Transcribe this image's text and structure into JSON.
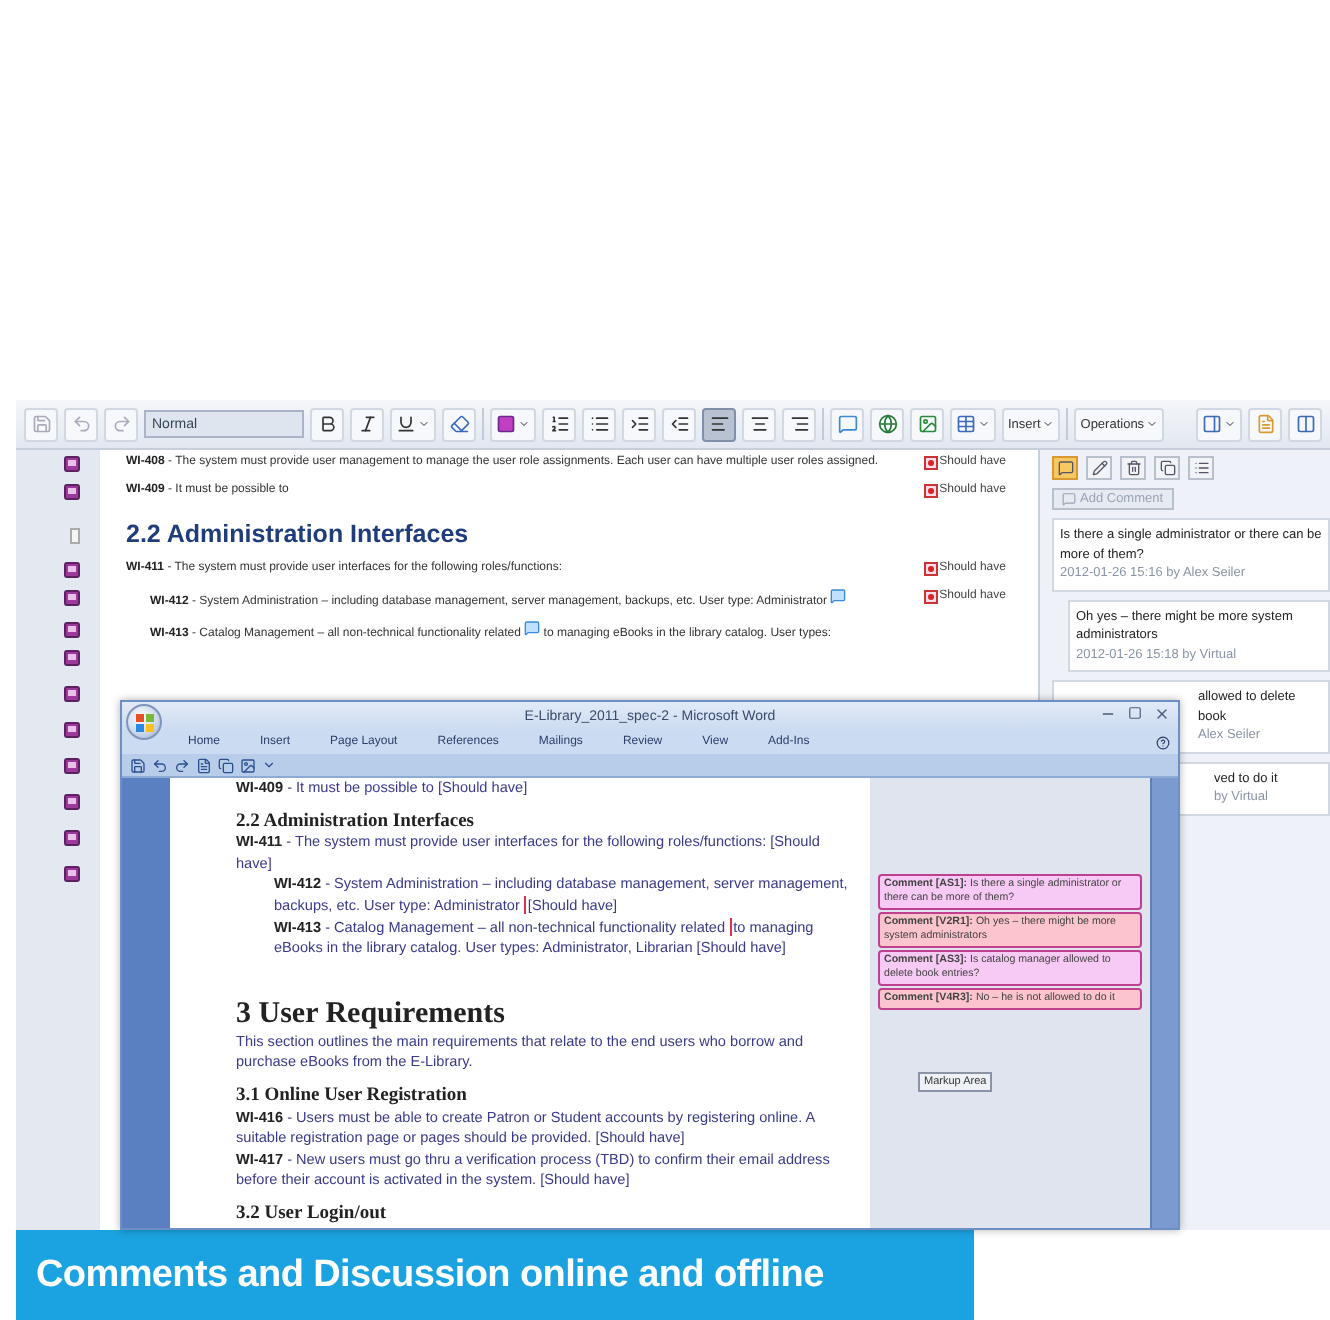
{
  "toolbar": {
    "style": "Normal",
    "insert": "Insert",
    "operations": "Operations",
    "align_buttons": [
      {
        "kind": "left",
        "selected": true
      },
      {
        "kind": "center",
        "selected": false
      },
      {
        "kind": "right",
        "selected": false
      }
    ]
  },
  "document": {
    "rows": [
      {
        "kind": "requirement",
        "id": "WI-408",
        "text": "- The system must provide user management to manage the user role assignments. Each user can have multiple user roles assigned.",
        "priority": "Should have"
      },
      {
        "kind": "requirement",
        "id": "WI-409",
        "text": "- It must be possible to",
        "priority": "Should have"
      },
      {
        "kind": "heading",
        "text": "2.2 Administration Interfaces"
      },
      {
        "kind": "requirement",
        "id": "WI-411",
        "text": "- The system must provide user interfaces for the following roles/functions:",
        "priority": "Should have",
        "children": [
          {
            "kind": "requirement",
            "id": "WI-412",
            "text": "- System Administration – including database management, server management, backups, etc. User type: Administrator",
            "has_comment": true,
            "priority": "Should have"
          },
          {
            "kind": "requirement",
            "id": "WI-413",
            "text": "- Catalog Management – all non-technical functionality related",
            "has_comment": true,
            "text_after": "to managing eBooks in the library catalog. User types:"
          }
        ]
      }
    ]
  },
  "side_panel": {
    "tools": [
      {
        "kind": "comment",
        "selected": true
      },
      {
        "kind": "edit",
        "selected": false
      },
      {
        "kind": "delete",
        "selected": false
      },
      {
        "kind": "copy",
        "selected": false
      },
      {
        "kind": "list",
        "selected": false
      }
    ],
    "add_comment": {
      "label": "Add Comment",
      "disabled": true
    },
    "comments": [
      {
        "kind": "full",
        "reply": false,
        "text": "Is there a single administrator or there can be more of them?",
        "meta": "2012-01-26 15:16 by Alex Seiler"
      },
      {
        "kind": "full",
        "reply": true,
        "text": "Oh yes – there might be more system administrators",
        "meta": "2012-01-26 15:18 by Virtual"
      },
      {
        "kind": "partial",
        "reply": false,
        "text": "allowed to delete book",
        "meta": "Alex Seiler"
      },
      {
        "kind": "partial",
        "reply": true,
        "text": "ved to do it",
        "meta": "by Virtual"
      }
    ]
  },
  "word": {
    "title": "E-Library_2011_spec-2 - Microsoft Word",
    "tabs": [
      "Home",
      "Insert",
      "Page Layout",
      "References",
      "Mailings",
      "Review",
      "View",
      "Add-Ins"
    ],
    "content": [
      {
        "kind": "req",
        "id": "WI-409",
        "text": "- It must be possible to [Should have]"
      },
      {
        "kind": "h2",
        "text": "2.2 Administration Interfaces"
      },
      {
        "kind": "req",
        "id": "WI-411",
        "text": "- The system must provide user interfaces for the following roles/functions: [Should have]",
        "children": [
          {
            "kind": "req",
            "id": "WI-412",
            "text": "- System Administration – including database management, server management, backups, etc. User type: Administrator",
            "marked": "[Should have]"
          },
          {
            "kind": "req",
            "id": "WI-413",
            "text": "- Catalog Management – all non-technical functionality related",
            "marked": "to managing eBooks",
            "text_after": "in the library catalog. User types: Administrator, Librarian [Should have]"
          }
        ]
      },
      {
        "kind": "h1",
        "text": "3 User Requirements"
      },
      {
        "kind": "p",
        "text": "This section outlines the main requirements that relate to the end users who borrow and purchase eBooks from the E-Library."
      },
      {
        "kind": "h2",
        "text": "3.1 Online User Registration"
      },
      {
        "kind": "req",
        "id": "WI-416",
        "text": "- Users must be able to create Patron or Student accounts by registering online. A suitable registration page or pages should be provided. [Should have]"
      },
      {
        "kind": "req",
        "id": "WI-417",
        "text": "- New users must go thru a verification process (TBD) to confirm their email address before their account is activated in the system. [Should have]"
      },
      {
        "kind": "h2",
        "text": "3.2 User Login/out"
      }
    ],
    "balloons": [
      {
        "label": "Comment [AS1]:",
        "text": "Is there a single administrator or there can be more of them?",
        "color": "#f7c9f5"
      },
      {
        "label": "Comment [V2R1]:",
        "text": "Oh yes – there might be more system administrators",
        "color": "#fcc4cc"
      },
      {
        "label": "Comment [AS3]:",
        "text": "Is catalog manager allowed to delete book entries?",
        "color": "#f7c9f5"
      },
      {
        "label": "Comment [V4R3]:",
        "text": "No – he is not allowed to do it",
        "color": "#fcc4cc"
      }
    ],
    "markup_area": "Markup Area"
  },
  "banner": "Comments and Discussion online and offline"
}
